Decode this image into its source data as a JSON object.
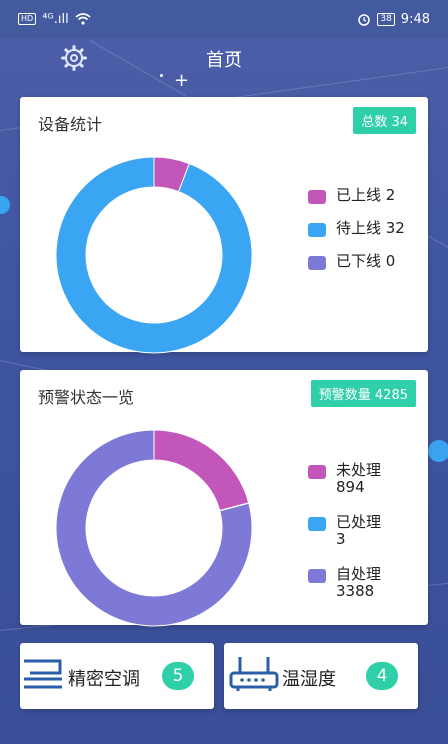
{
  "status_bar": {
    "network": "HD",
    "signal": "⁴ᴳ.ıll",
    "battery": "38",
    "time": "9:48"
  },
  "header": {
    "title": "首页",
    "settings_icon": "gear-icon"
  },
  "device_stats": {
    "title": "设备统计",
    "badge": "总数  34",
    "legend": [
      {
        "label": "已上线 2",
        "color": "#c256b9",
        "value": 2
      },
      {
        "label": "待上线 32",
        "color": "#3aa5f2",
        "value": 32
      },
      {
        "label": "已下线 0",
        "color": "#7e78d6",
        "value": 0
      }
    ]
  },
  "alert_status": {
    "title": "预警状态一览",
    "badge": "预警数量  4285",
    "legend": [
      {
        "label": "未处理",
        "count": "894",
        "color": "#c256b9",
        "value": 894
      },
      {
        "label": "已处理",
        "count": "3",
        "color": "#3aa5f2",
        "value": 3
      },
      {
        "label": "自处理",
        "count": "3388",
        "color": "#7e78d6",
        "value": 3388
      }
    ]
  },
  "shortcuts": [
    {
      "label": "精密空调",
      "count": "5",
      "icon": "air-conditioner-icon"
    },
    {
      "label": "温湿度",
      "count": "4",
      "icon": "router-icon"
    }
  ],
  "chart_data": [
    {
      "type": "pie",
      "categories": [
        "已上线",
        "待上线",
        "已下线"
      ],
      "values": [
        2,
        32,
        0
      ],
      "colors": [
        "#c256b9",
        "#3aa5f2",
        "#7e78d6"
      ],
      "donut": true
    },
    {
      "type": "pie",
      "categories": [
        "未处理",
        "已处理",
        "自处理"
      ],
      "values": [
        894,
        3,
        3388
      ],
      "colors": [
        "#c256b9",
        "#3aa5f2",
        "#7e78d6"
      ],
      "donut": true
    }
  ]
}
